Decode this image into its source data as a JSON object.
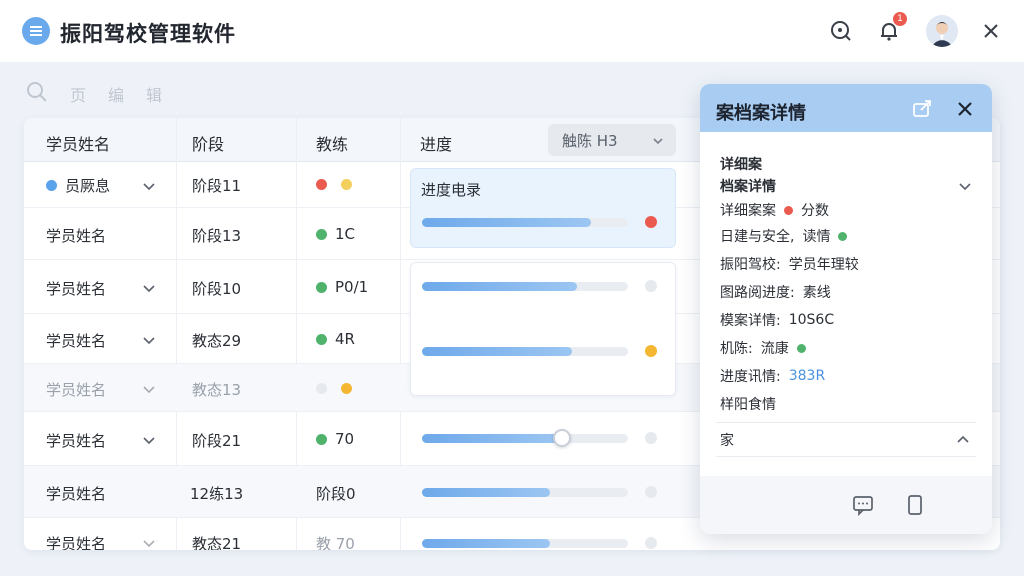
{
  "header": {
    "app_title": "振阳驾校管理软件",
    "notification_count": "1",
    "icons": [
      "menu-icon",
      "search-icon",
      "bell-icon",
      "avatar",
      "close-icon"
    ]
  },
  "toolbar": {
    "items": [
      "页",
      "编",
      "辑"
    ]
  },
  "table": {
    "columns": [
      "学员姓名",
      "阶段",
      "教练",
      "进度"
    ],
    "filter_select": "触陈 H3",
    "rows": [
      {
        "name": "员厥息",
        "stage": "阶段11",
        "coach": "",
        "coach_dots": [
          "#ea5a4f",
          "#f3cf5d"
        ],
        "progress": 0.82,
        "end_dot": "#ea5a4f"
      },
      {
        "name": "学员姓名",
        "stage": "阶段13",
        "coach": "1C",
        "coach_dots": [
          "#4fb36c"
        ],
        "progress": null,
        "end_dot": ""
      },
      {
        "name": "学员姓名",
        "stage": "阶段10",
        "coach": "P0/1",
        "coach_dots": [
          "#4fb36c"
        ],
        "progress": 0.75,
        "end_dot": "#e6e9ee"
      },
      {
        "name": "学员姓名",
        "stage": "教态29",
        "coach": "4R",
        "coach_dots": [
          "#4fb36c"
        ],
        "progress": 0.73,
        "end_dot": "#f5b731"
      },
      {
        "name": "学员姓名",
        "stage": "教态13",
        "coach": "",
        "coach_dots": [
          "#e6e9ee",
          "#f5b731"
        ],
        "progress": null,
        "end_dot": ""
      },
      {
        "name": "学员姓名",
        "stage": "阶段21",
        "coach": "70",
        "coach_dots": [
          "#4fb36c"
        ],
        "progress": 0.68,
        "end_dot": "#e6e9ee"
      },
      {
        "name": "学员姓名",
        "stage": "12练13",
        "coach": "阶段0",
        "coach_dots": [],
        "progress": 0.62,
        "end_dot": "#e6e9ee"
      },
      {
        "name": "学员姓名",
        "stage": "教态21",
        "coach": "教 70",
        "coach_dots": [],
        "progress": 0.62,
        "end_dot": "#e6e9ee"
      }
    ],
    "progress_card_title": "进度电录"
  },
  "detail_panel": {
    "title": "案档案详情",
    "section_label": "详细案",
    "subsection_label": "档案详情",
    "lines": [
      {
        "label": "详细案案",
        "value": "分数",
        "dot": "#ea5a4f"
      },
      {
        "label": "日建与安全,",
        "value": "读情",
        "dot": "#4fb36c"
      },
      {
        "label": "振阳驾校:",
        "value": "学员年理较",
        "dot": ""
      },
      {
        "label": "图路阅进度:",
        "value": "素线",
        "dot": ""
      },
      {
        "label": "模案详情:",
        "value": "10S6C",
        "dot": ""
      },
      {
        "label": "机陈:",
        "value": "流康",
        "dot": "#4fb36c"
      },
      {
        "label": "进度讯情:",
        "value": "383R",
        "dot": ""
      }
    ],
    "extra_line": "样阳食情",
    "collapse_label": "家",
    "colors": {
      "header_bg": "#a9cdf2",
      "accent": "#4a92e0"
    }
  }
}
